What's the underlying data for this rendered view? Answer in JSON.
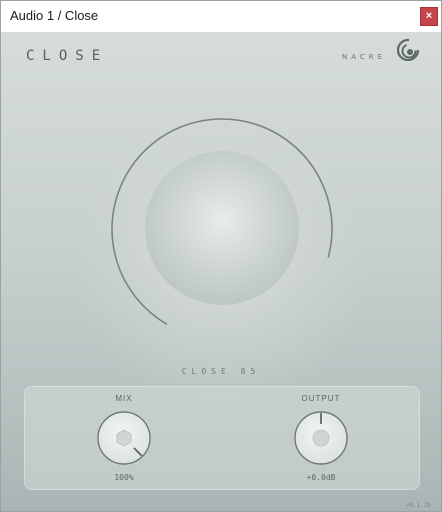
{
  "window": {
    "title": "Audio 1 / Close",
    "close_label": "×"
  },
  "plugin": {
    "name": "CLOSE",
    "brand": "NACRE",
    "param_readout": "CLOSE 85",
    "close_level_percent": 85,
    "version": "v0.1.2b"
  },
  "controls": {
    "mix": {
      "label": "MIX",
      "value": "100%",
      "level": 1.0
    },
    "output": {
      "label": "OUTPUT",
      "value": "+0.0dB",
      "level": 0.5
    }
  },
  "colors": {
    "close_button": "#c4454a",
    "arc": "#7a8482",
    "background_top": "#d5dcdb",
    "background_bottom": "#a9b5b4"
  }
}
